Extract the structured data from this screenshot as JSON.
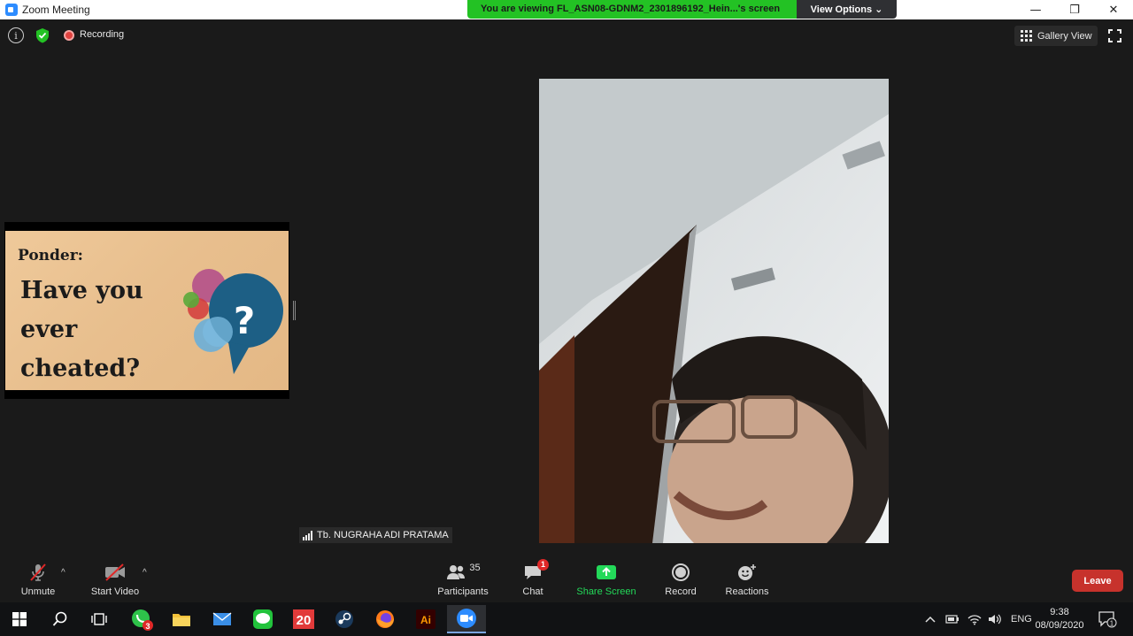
{
  "window": {
    "title": "Zoom Meeting",
    "minimize_glyph": "—",
    "restore_glyph": "❐",
    "close_glyph": "✕"
  },
  "share_banner": {
    "message": "You are viewing FL_ASN08-GDNM2_2301896192_Hein...'s screen",
    "options_label": "View Options ⌄"
  },
  "top_bar": {
    "recording_label": "Recording",
    "gallery_view_label": "Gallery View",
    "info_glyph": "i"
  },
  "shared_slide": {
    "heading": "Ponder:",
    "question_line1": "Have you",
    "question_line2": "ever",
    "question_line3": "cheated?",
    "bubble_symbol": "?"
  },
  "video": {
    "participant_name": "Tb. NUGRAHA ADI PRATAMA"
  },
  "toolbar": {
    "unmute_label": "Unmute",
    "start_video_label": "Start Video",
    "participants_label": "Participants",
    "participants_count": "35",
    "chat_label": "Chat",
    "chat_badge": "1",
    "share_screen_label": "Share Screen",
    "record_label": "Record",
    "reactions_label": "Reactions",
    "leave_label": "Leave",
    "caret": "^"
  },
  "taskbar": {
    "whatsapp_badge": "3",
    "calendar_number": "20",
    "illustrator_label": "Ai",
    "language": "ENG",
    "time": "9:38",
    "date": "08/09/2020",
    "notification_count": "1"
  },
  "colors": {
    "zoom_blue": "#2d8cff",
    "banner_green": "#23c224",
    "share_green": "#23d959",
    "leave_red": "#c7322c",
    "badge_red": "#e02828"
  }
}
